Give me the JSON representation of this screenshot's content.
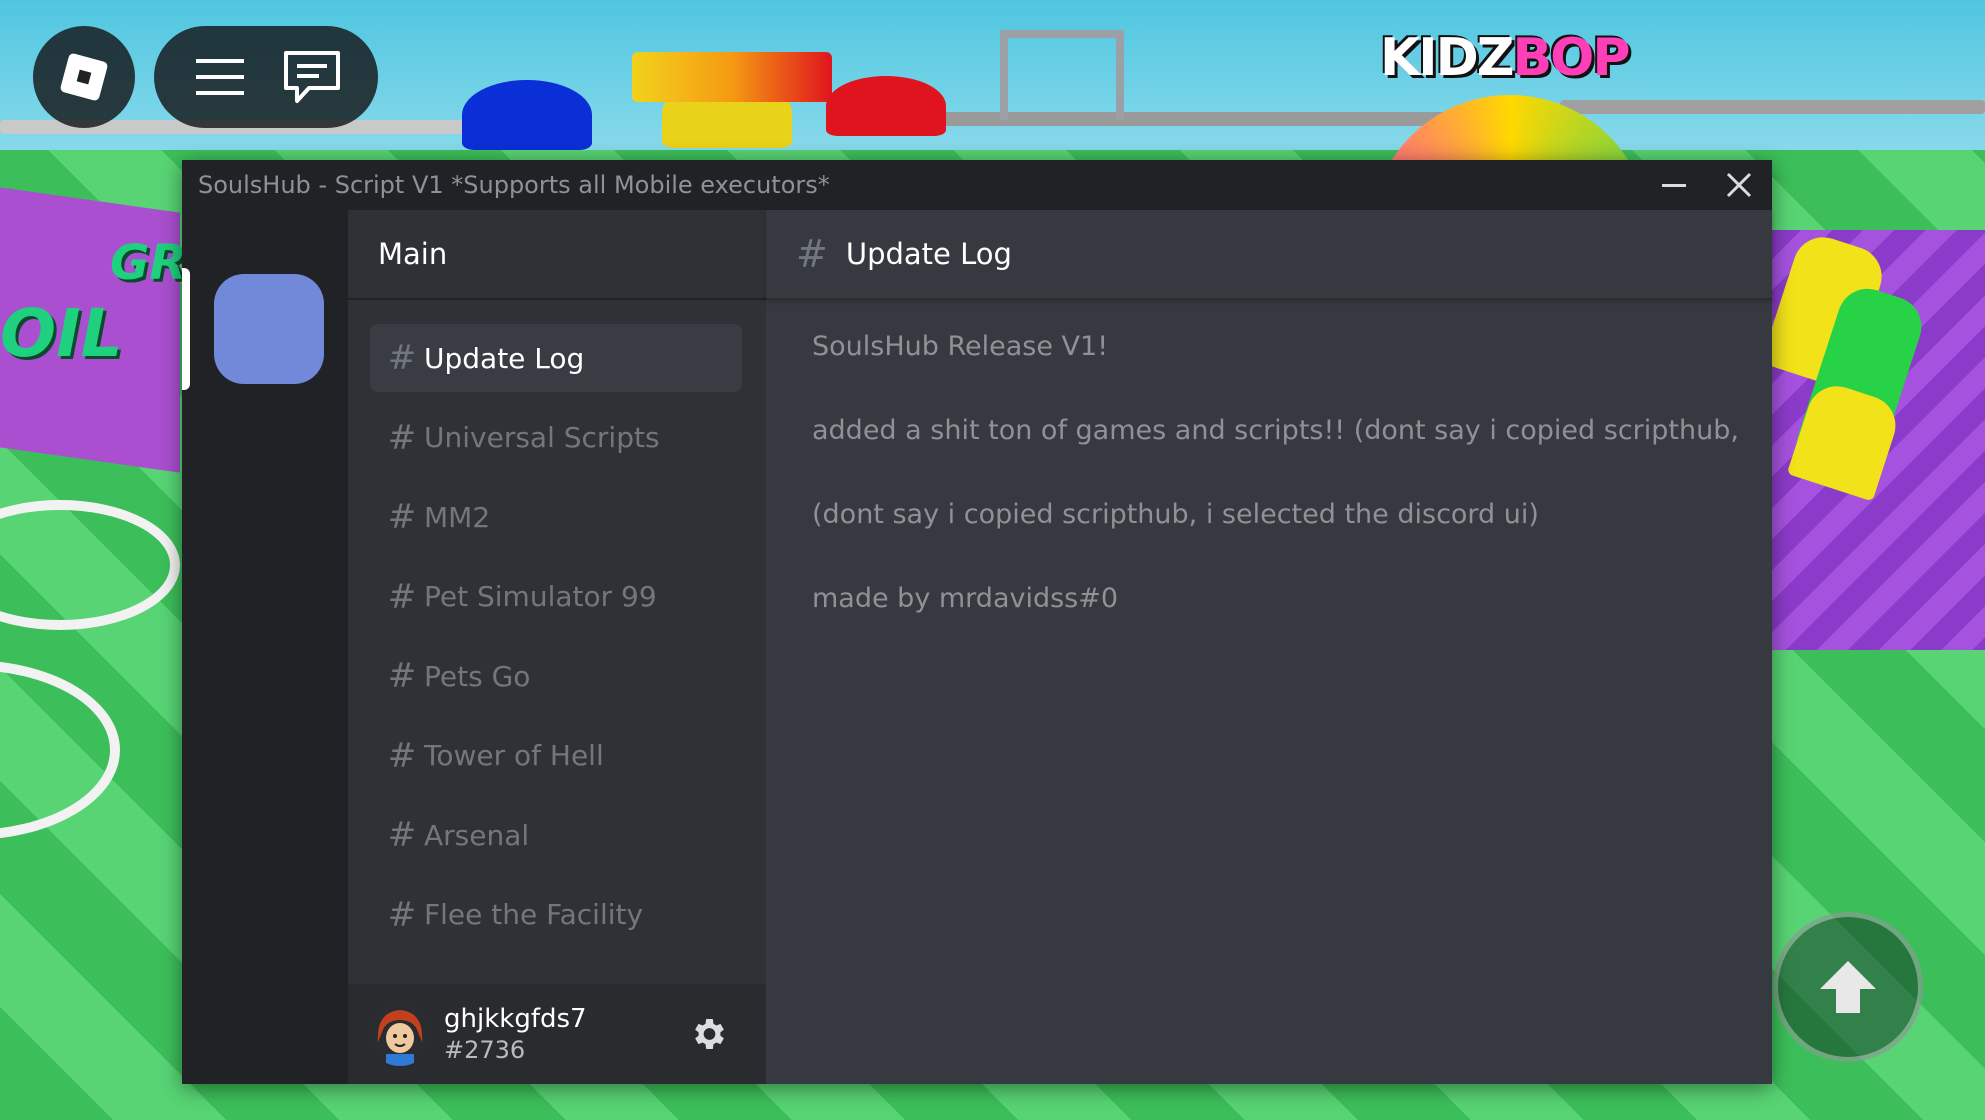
{
  "window": {
    "title": "SoulsHub - Script V1 *Supports all Mobile executors*",
    "minimize_icon": "minimize-icon",
    "close_icon": "close-icon"
  },
  "server": {
    "icon_color": "#7289da"
  },
  "sidebar": {
    "header": "Main",
    "channels": [
      {
        "label": "Update Log",
        "active": true
      },
      {
        "label": "Universal Scripts"
      },
      {
        "label": "MM2"
      },
      {
        "label": "Pet Simulator 99"
      },
      {
        "label": "Pets Go"
      },
      {
        "label": "Tower of Hell"
      },
      {
        "label": "Arsenal"
      },
      {
        "label": "Flee the Facility"
      }
    ]
  },
  "user": {
    "name": "ghjkkgfds7",
    "tag": "#2736",
    "settings_icon": "gear-icon"
  },
  "content": {
    "channel_title": "Update Log",
    "messages": [
      "SoulsHub Release V1!",
      "added a shit ton of games and scripts!! (dont say i copied scripthub,",
      "(dont say i copied scripthub, i selected the discord ui)",
      "made by mrdavidss#0"
    ]
  },
  "game": {
    "sign_kidz": "KIDZ",
    "sign_bop": "BOP",
    "sign_left_1": "GRI",
    "sign_left_2": "OIL"
  },
  "colors": {
    "titlebar": "#202225",
    "sidebar": "#2f3136",
    "content": "#36393f",
    "accent": "#7289da"
  }
}
